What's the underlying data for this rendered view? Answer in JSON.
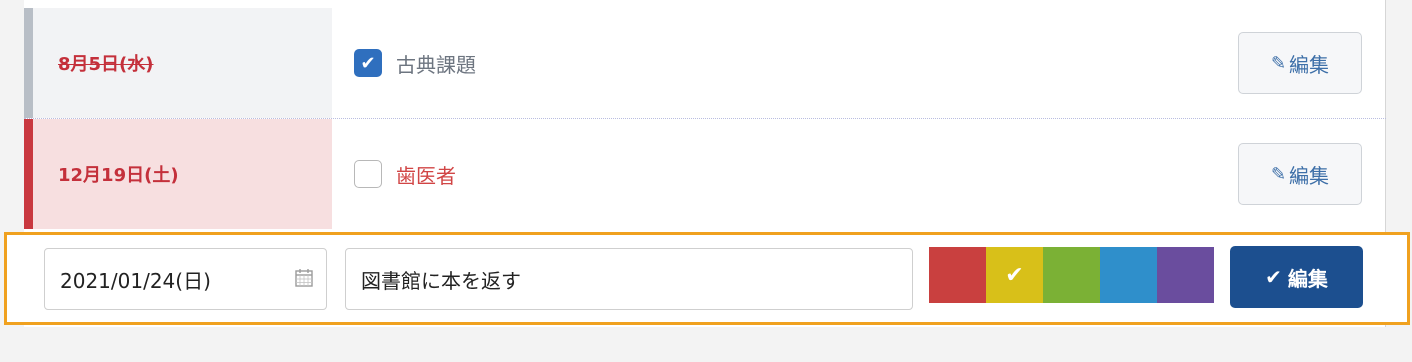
{
  "tasks": [
    {
      "date": "8月5日(水)",
      "label": "古典課題",
      "checked": true,
      "edit_label": "編集",
      "edit_icon": "pencil-icon",
      "date_color": "#c4303b",
      "bar_color": "#b8bec6"
    },
    {
      "date": "12月19日(土)",
      "label": "歯医者",
      "checked": false,
      "edit_label": "編集",
      "edit_icon": "pencil-icon",
      "date_color": "#c4303b",
      "bar_color": "#c9383f"
    }
  ],
  "edit_form": {
    "date_value": "2021/01/24(日)",
    "date_icon": "calendar-icon",
    "task_value": "図書館に本を返す",
    "colors": [
      {
        "name": "red",
        "hex": "#c9403f",
        "selected": false
      },
      {
        "name": "yellow",
        "hex": "#d8c019",
        "selected": true
      },
      {
        "name": "green",
        "hex": "#7bb135",
        "selected": false
      },
      {
        "name": "blue",
        "hex": "#2f8fcb",
        "selected": false
      },
      {
        "name": "purple",
        "hex": "#6a4d9e",
        "selected": false
      }
    ],
    "save_label": "編集",
    "save_icon": "check-icon"
  },
  "colors": {
    "highlight_border": "#f0a11f",
    "save_button": "#1c4f8f",
    "checkbox_checked": "#2f6fbe"
  }
}
